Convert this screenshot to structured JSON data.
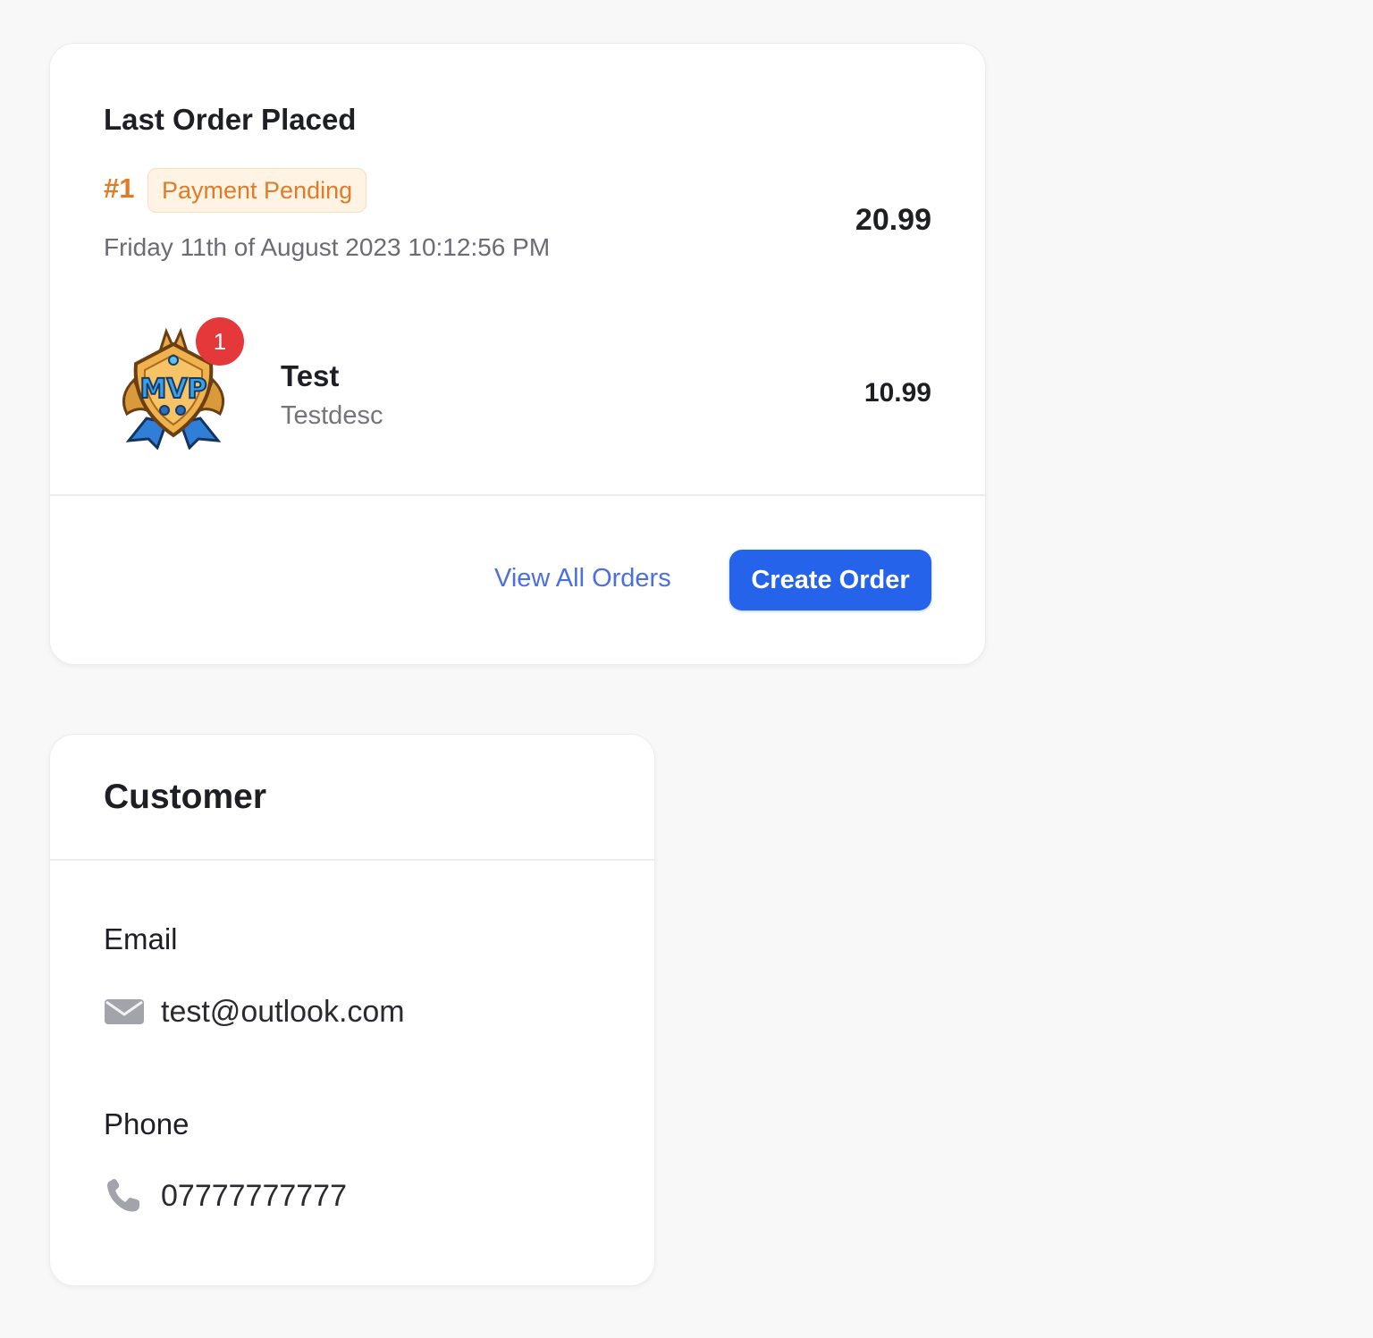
{
  "last_order": {
    "title": "Last Order Placed",
    "number": "#1",
    "status": "Payment Pending",
    "date": "Friday 11th of August 2023 10:12:56 PM",
    "total": "20.99",
    "items": [
      {
        "quantity": "1",
        "name": "Test",
        "description": "Testdesc",
        "price": "10.99",
        "image": "mvp-badge-icon"
      }
    ],
    "view_all_label": "View All Orders",
    "create_order_label": "Create Order"
  },
  "customer": {
    "title": "Customer",
    "email_label": "Email",
    "email": "test@outlook.com",
    "email_icon": "envelope-icon",
    "phone_label": "Phone",
    "phone": "07777777777",
    "phone_icon": "phone-icon"
  },
  "colors": {
    "accent_blue": "#2563eb",
    "link_blue": "#4c6fe0",
    "status_orange": "#e07b27",
    "status_bg": "#fff3e3",
    "badge_red": "#e5383b"
  }
}
